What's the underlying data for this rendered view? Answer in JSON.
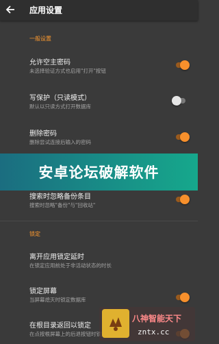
{
  "header": {
    "title": "应用设置"
  },
  "sections": {
    "general": "一般设置",
    "lock": "锁定"
  },
  "rows": [
    {
      "title": "允许空主密码",
      "subtitle": "未选择验证方式也启用\"打开\"按钮",
      "toggle": true
    },
    {
      "title": "写保护（只读模式）",
      "subtitle": "默认以只读方式打开数据库",
      "toggle": false
    },
    {
      "title": "删除密码",
      "subtitle": "删除尝试连接后输入的密码",
      "toggle": true
    },
    {
      "title": "搜索时忽略备份条目",
      "subtitle": "搜索时忽略\"备份\"与\"回收站\"",
      "toggle": true
    },
    {
      "title": "离开应用锁定延时",
      "subtitle": "在锁定应用前处于非活动状态的时长",
      "toggle": null
    },
    {
      "title": "锁定屏幕",
      "subtitle": "当屏幕熄灭时锁定数据库",
      "toggle": true
    },
    {
      "title": "在根目录返回以锁定",
      "subtitle": "在点按根屏幕上的后退按钮时锁定数据库",
      "toggle": true
    }
  ],
  "banner": {
    "text": "安卓论坛破解软件"
  },
  "watermark": {
    "name": "八神智能天下",
    "url": "zntx.cc"
  },
  "colors": {
    "accent": "#f7902c",
    "background": "#3a3a3a",
    "banner": "#16a88c"
  }
}
